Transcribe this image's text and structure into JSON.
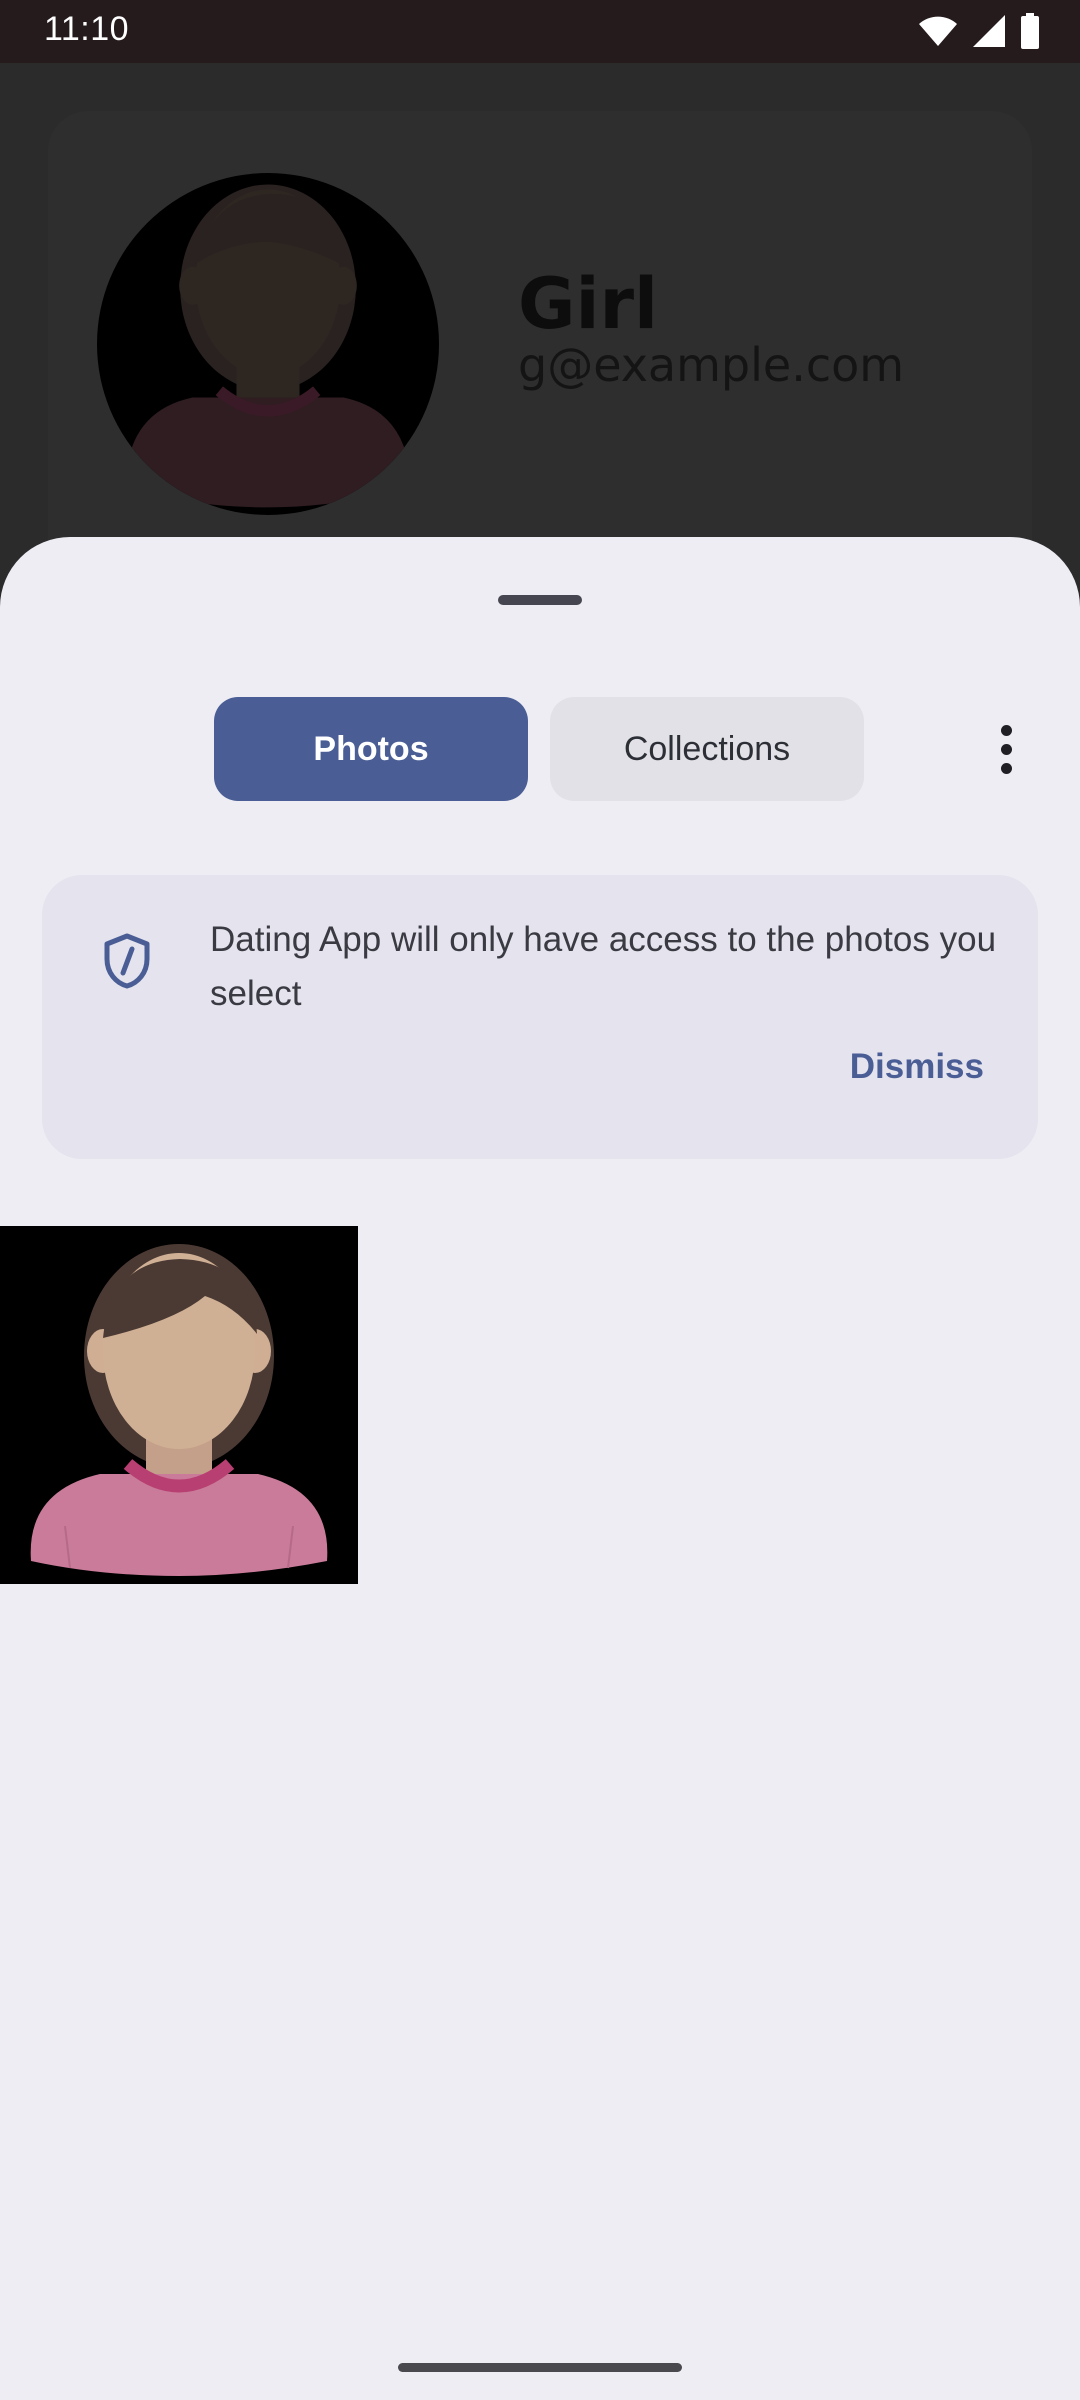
{
  "status_bar": {
    "time": "11:10",
    "icons": [
      "wifi-icon",
      "signal-icon",
      "battery-icon"
    ]
  },
  "profile": {
    "name": "Girl",
    "email": "g@example.com",
    "avatar": "girl-avatar"
  },
  "sheet": {
    "tabs": [
      {
        "label": "Photos",
        "selected": true
      },
      {
        "label": "Collections",
        "selected": false
      }
    ],
    "menu_icon": "more-vert-icon",
    "banner": {
      "icon": "shield-icon",
      "text": "Dating App will only have access to the photos you select",
      "dismiss_label": "Dismiss"
    },
    "photos": [
      {
        "name": "girl-avatar-photo"
      }
    ]
  },
  "colors": {
    "accent": "#4a5e95",
    "sheet_bg": "#eeedf4",
    "status_bar_bg": "#251b1c"
  }
}
